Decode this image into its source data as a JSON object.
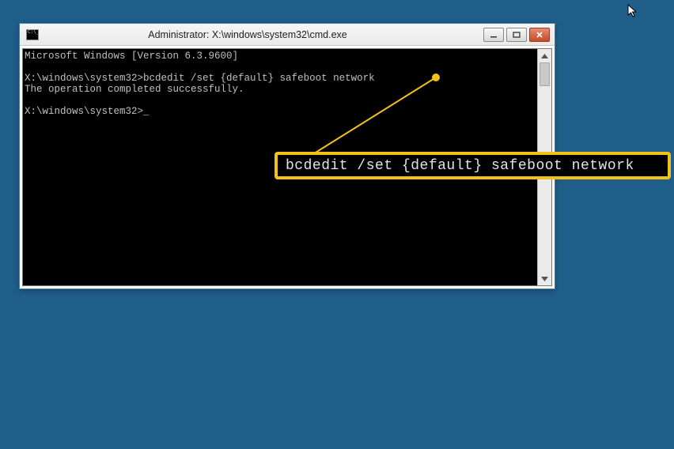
{
  "window": {
    "title": "Administrator: X:\\windows\\system32\\cmd.exe"
  },
  "terminal": {
    "version_line": "Microsoft Windows [Version 6.3.9600]",
    "prompt1": "X:\\windows\\system32>",
    "command1": "bcdedit /set {default} safeboot network",
    "result1": "The operation completed successfully.",
    "prompt2": "X:\\windows\\system32>",
    "cursor_char": "_"
  },
  "callout": {
    "text": "bcdedit /set {default} safeboot network"
  }
}
